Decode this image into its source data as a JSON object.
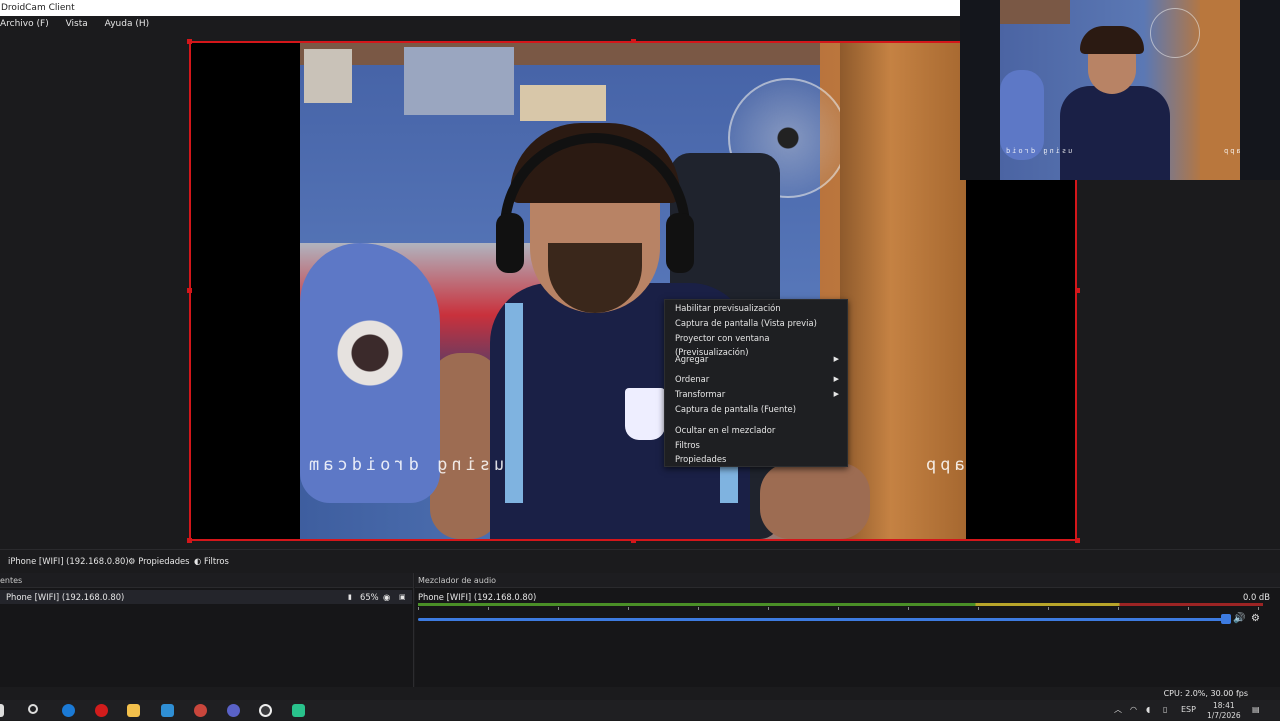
{
  "window": {
    "title": "DroidCam Client"
  },
  "menu": {
    "items": [
      "Archivo (F)",
      "Vista",
      "Ayuda (H)"
    ]
  },
  "preview": {
    "watermark_left": "using droidcam",
    "watermark_right": "app",
    "pip_watermark_left": "using droid",
    "pip_watermark_right": "app"
  },
  "context_menu": {
    "items": [
      {
        "label": "Habilitar previsualización",
        "submenu": false
      },
      {
        "label": "Captura de pantalla (Vista previa)",
        "submenu": false
      },
      {
        "label": "Proyector con ventana (Previsualización)",
        "submenu": false
      },
      {
        "label": "Agregar",
        "submenu": true
      },
      {
        "label": "Ordenar",
        "submenu": true
      },
      {
        "label": "Transformar",
        "submenu": true
      },
      {
        "label": "Captura de pantalla (Fuente)",
        "submenu": false
      },
      {
        "label": "Ocultar en el mezclador",
        "submenu": false
      },
      {
        "label": "Filtros",
        "submenu": false
      },
      {
        "label": "Propiedades",
        "submenu": false
      }
    ]
  },
  "toolbar": {
    "source_name": "iPhone [WIFI] (192.168.0.80)",
    "properties_label": "Propiedades",
    "filters_label": "Filtros"
  },
  "sources": {
    "header": "entes",
    "row_name": "Phone [WIFI] (192.168.0.80)",
    "opacity": "65%"
  },
  "mixer": {
    "header": "Mezclador de audio",
    "channel_name": "Phone [WIFI] (192.168.0.80)",
    "level_db": "0.0 dB",
    "volume_fraction": 0.955
  },
  "status": {
    "cpu": "CPU: 2.0%, 30.00 fps"
  },
  "taskbar": {
    "language": "ESP",
    "time": "18:41",
    "date": "1/7/2026"
  },
  "icons": [
    "gear-icon",
    "filter-icon",
    "eye-icon",
    "lock-icon",
    "speaker-icon",
    "settings-icon",
    "search-icon",
    "windows-start-icon"
  ],
  "colors": {
    "selection": "#d4161a",
    "accent": "#3d7be0"
  }
}
